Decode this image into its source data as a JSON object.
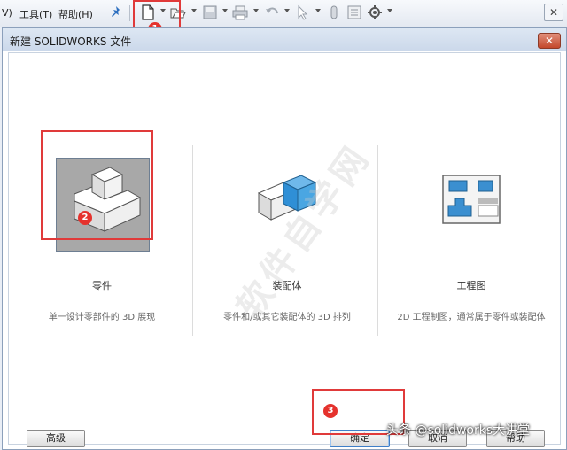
{
  "menu": {
    "partial_item": "V)",
    "tools": "工具(T)",
    "help": "帮助(H)"
  },
  "dialog": {
    "title": "新建 SOLIDWORKS 文件",
    "close_glyph": "✕"
  },
  "templates": [
    {
      "label": "零件",
      "description": "单一设计零部件的 3D 展现",
      "selected": true
    },
    {
      "label": "装配体",
      "description": "零件和/或其它装配体的 3D 排列",
      "selected": false
    },
    {
      "label": "工程图",
      "description": "2D 工程制图，通常属于零件或装配体",
      "selected": false
    }
  ],
  "buttons": {
    "advanced": "高级",
    "ok": "确定",
    "cancel": "取消",
    "help": "帮助"
  },
  "annotations": {
    "step1": "1",
    "step2": "2",
    "step3": "3"
  },
  "watermark": "软件自学网",
  "credit": "头条 @solidworks大讲堂",
  "colors": {
    "highlight_red": "#e03a3a",
    "badge_red": "#e5322d",
    "assembly_blue": "#2f8fd6"
  }
}
